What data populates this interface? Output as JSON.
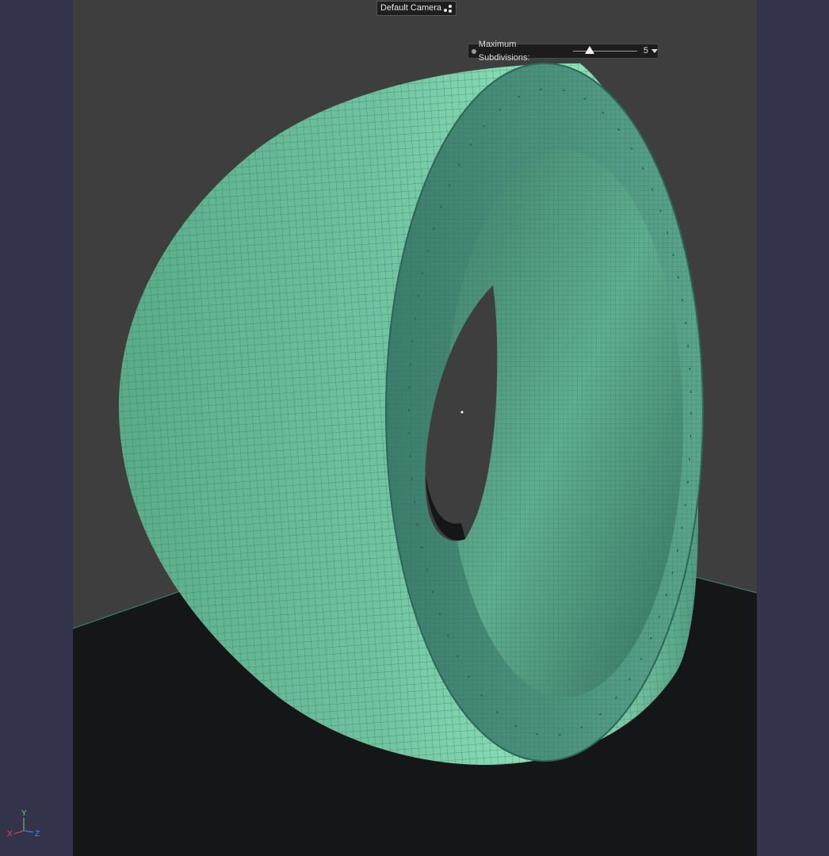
{
  "viewport": {
    "camera_label": "Default Camera",
    "background_color": "#3e3e3e",
    "floor_color": "#151618"
  },
  "subdivisions": {
    "label": "Maximum Subdivisions:",
    "value": "5",
    "slider_min": 0,
    "slider_max": 20,
    "slider_fraction": 0.25
  },
  "axis_gizmo": {
    "x_label": "X",
    "y_label": "Y",
    "z_label": "Z",
    "x_color": "#e0504a",
    "y_color": "#6fd07a",
    "z_color": "#4a8fe0"
  },
  "model": {
    "type": "tire-mesh",
    "mesh_color": "#6cc39e",
    "wire_color": "#2f6d5c"
  }
}
